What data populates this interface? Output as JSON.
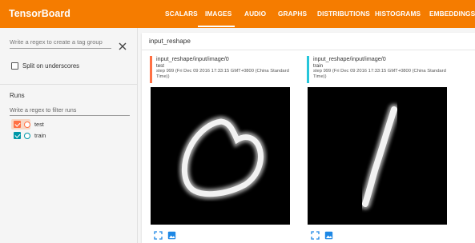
{
  "app": {
    "title": "TensorBoard"
  },
  "nav": {
    "tabs": [
      {
        "label": "SCALARS"
      },
      {
        "label": "IMAGES",
        "active": true
      },
      {
        "label": "AUDIO"
      },
      {
        "label": "GRAPHS"
      },
      {
        "label": "DISTRIBUTIONS"
      },
      {
        "label": "HISTOGRAMS"
      },
      {
        "label": "EMBEDDINGS"
      }
    ]
  },
  "sidebar": {
    "tag_group_placeholder": "Write a regex to create a tag group",
    "split_label": "Split on underscores",
    "split_checked": false,
    "runs_title": "Runs",
    "runs_filter_placeholder": "Write a regex to filter runs",
    "runs": [
      {
        "name": "test",
        "checked": true,
        "color": "#ff7043"
      },
      {
        "name": "train",
        "checked": true,
        "color": "#0097a7"
      }
    ]
  },
  "main": {
    "section_title": "input_reshape",
    "cards": [
      {
        "tag": "input_reshape/input/image/0",
        "run": "test",
        "step": "step 999 (Fri Dec 09 2016 17:33:15 GMT+0800 (China Standard Time))",
        "color": "#ff7043",
        "image_icon": "handwritten-zero-digit"
      },
      {
        "tag": "input_reshape/input/image/0",
        "run": "train",
        "step": "step 999 (Fri Dec 09 2016 17:33:15 GMT+0800 (China Standard Time))",
        "color": "#26c6da",
        "image_icon": "handwritten-one-digit"
      }
    ]
  },
  "colors": {
    "header": "#f57c00",
    "icon_blue": "#1e88e5"
  }
}
